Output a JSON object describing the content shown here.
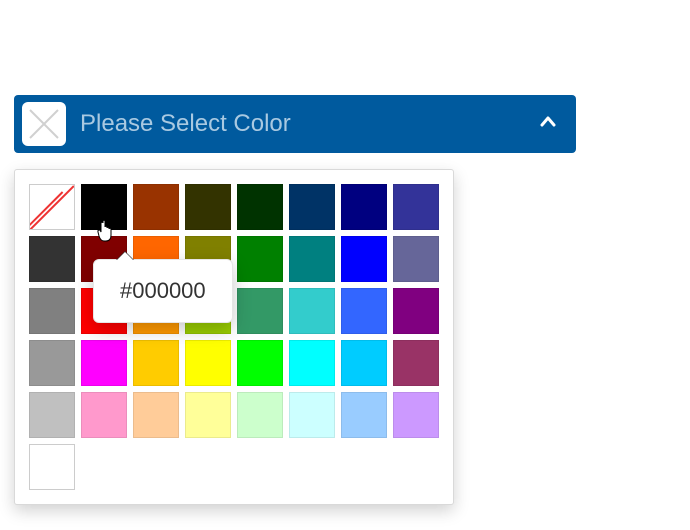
{
  "dropdown": {
    "placeholder": "Please Select Color",
    "expanded": true
  },
  "tooltip": {
    "text": "#000000"
  },
  "palette": {
    "none_label": "none",
    "rows": [
      [
        "none",
        "#000000",
        "#993300",
        "#333300",
        "#003300",
        "#003366",
        "#000080",
        "#333399"
      ],
      [
        "#333333",
        "#800000",
        "#ff6600",
        "#808000",
        "#008000",
        "#008080",
        "#0000ff",
        "#666699"
      ],
      [
        "#808080",
        "#ff0000",
        "#ff9900",
        "#99cc00",
        "#339966",
        "#33cccc",
        "#3366ff",
        "#800080"
      ],
      [
        "#999999",
        "#ff00ff",
        "#ffcc00",
        "#ffff00",
        "#00ff00",
        "#00ffff",
        "#00ccff",
        "#993366"
      ],
      [
        "#c0c0c0",
        "#ff99cc",
        "#ffcc99",
        "#ffff99",
        "#ccffcc",
        "#ccffff",
        "#99ccff",
        "#cc99ff"
      ]
    ],
    "extra": [
      "#ffffff"
    ]
  }
}
